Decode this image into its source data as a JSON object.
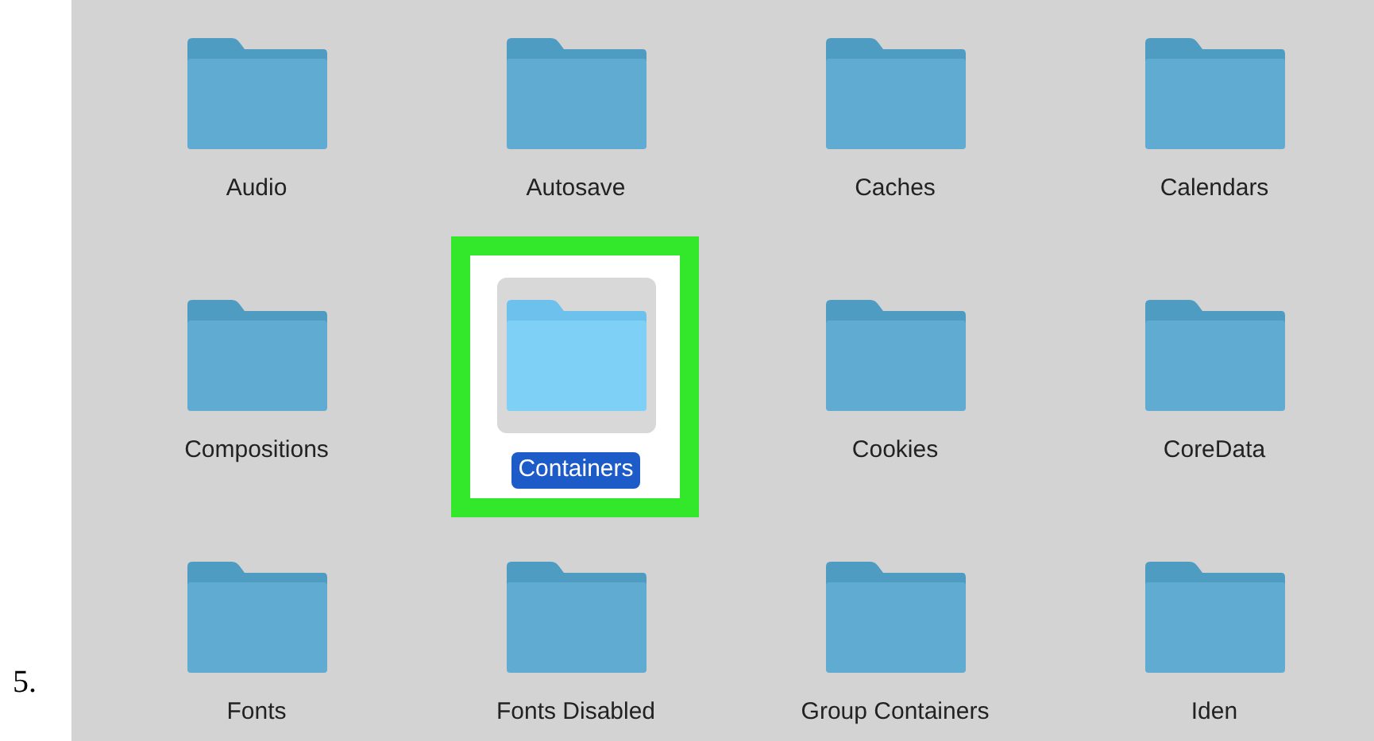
{
  "step_number": "5.",
  "folders": [
    {
      "name": "Audio",
      "selected": false
    },
    {
      "name": "Autosave",
      "selected": false
    },
    {
      "name": "Caches",
      "selected": false
    },
    {
      "name": "Calendars",
      "selected": false
    },
    {
      "name": "Compositions",
      "selected": false
    },
    {
      "name": "Containers",
      "selected": true
    },
    {
      "name": "Cookies",
      "selected": false
    },
    {
      "name": "CoreData",
      "selected": false
    },
    {
      "name": "Fonts",
      "selected": false
    },
    {
      "name": "Fonts Disabled",
      "selected": false
    },
    {
      "name": "Group Containers",
      "selected": false
    },
    {
      "name": "Iden",
      "selected": false
    }
  ]
}
